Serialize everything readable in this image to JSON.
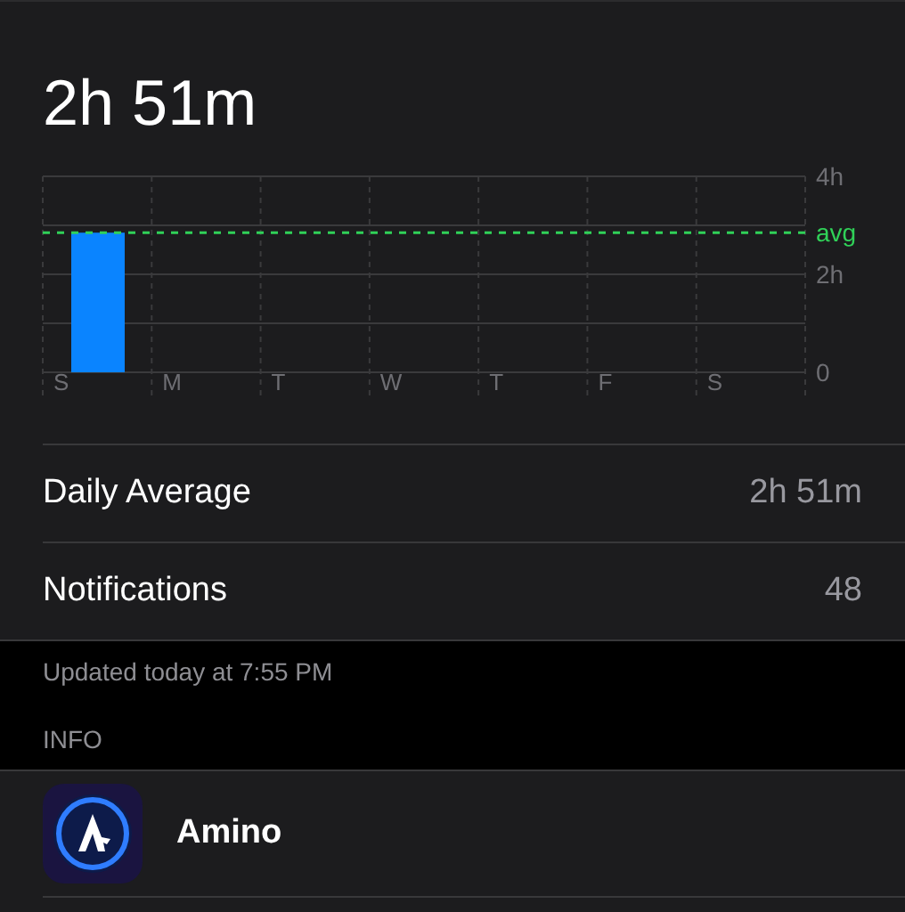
{
  "summary": {
    "total": "2h 51m"
  },
  "chart": {
    "chart_data": {
      "type": "bar",
      "categories": [
        "S",
        "M",
        "T",
        "W",
        "T",
        "F",
        "S"
      ],
      "values": [
        2.85,
        null,
        null,
        null,
        null,
        null,
        null
      ],
      "ylim": [
        0,
        4
      ],
      "yticks": [
        {
          "value": 0,
          "label": "0"
        },
        {
          "value": 2,
          "label": "2h"
        },
        {
          "value": 4,
          "label": "4h"
        }
      ],
      "ref_lines": [
        {
          "axis": "y",
          "value": 2.85,
          "label": "avg"
        }
      ]
    }
  },
  "stats": [
    {
      "label": "Daily Average",
      "value": "2h 51m"
    },
    {
      "label": "Notifications",
      "value": "48"
    }
  ],
  "updated": "Updated today at 7:55 PM",
  "section_header": "INFO",
  "apps": [
    {
      "name": "Amino"
    }
  ]
}
